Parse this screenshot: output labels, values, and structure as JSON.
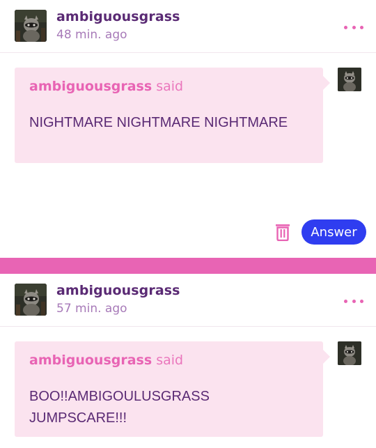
{
  "posts": [
    {
      "author": "ambiguousgrass",
      "time": "48 min. ago",
      "question": {
        "asker": "ambiguousgrass",
        "said": "said",
        "text": "NIGHTMARE NIGHTMARE NIGHTMARE"
      },
      "actions": {
        "answer_label": "Answer"
      }
    },
    {
      "author": "ambiguousgrass",
      "time": "57 min. ago",
      "question": {
        "asker": "ambiguousgrass",
        "said": "said",
        "text": "BOO!!AMBIGOULUSGRASS JUMPSCARE!!!"
      }
    }
  ],
  "icons": {
    "more": "more-horizontal-icon",
    "trash": "trash-icon",
    "avatar": "raccoon-avatar"
  },
  "colors": {
    "accent_pink": "#e864b4",
    "bubble_bg": "#fbe3ef",
    "username_purple": "#5a2a74",
    "timestamp_purple": "#a77ab8",
    "answer_blue": "#2f3df0"
  }
}
